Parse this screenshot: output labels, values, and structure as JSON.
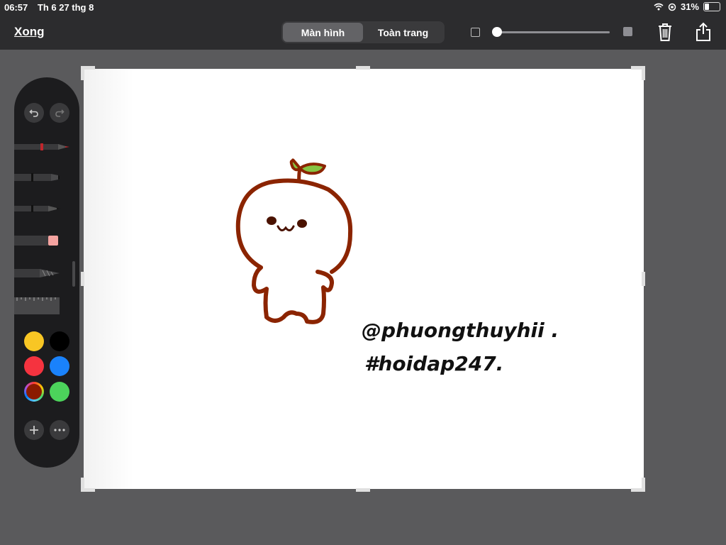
{
  "status": {
    "time": "06:57",
    "date": "Th 6 27 thg 8",
    "battery": "31%",
    "battery_level": 0.31
  },
  "toolbar": {
    "done_label": "Xong",
    "segments": [
      {
        "label": "Màn hình",
        "active": true
      },
      {
        "label": "Toàn trang",
        "active": false
      }
    ],
    "opacity_level": 0.0,
    "icons": [
      "trash-icon",
      "share-icon"
    ]
  },
  "palette": {
    "undo_icon": "undo-icon",
    "redo_icon": "redo-icon",
    "tools": [
      "pen",
      "marker",
      "pencil",
      "eraser",
      "lasso",
      "ruler"
    ],
    "colors": [
      "#f8c624",
      "#000000",
      "#f5333f",
      "#1a82fb",
      "#8b1a00",
      "#4cd35b"
    ],
    "selected_color": "#8b1a00"
  },
  "canvas": {
    "watermark_line1": "@phuongthuyhii .",
    "watermark_line2": "#hoidap247."
  }
}
